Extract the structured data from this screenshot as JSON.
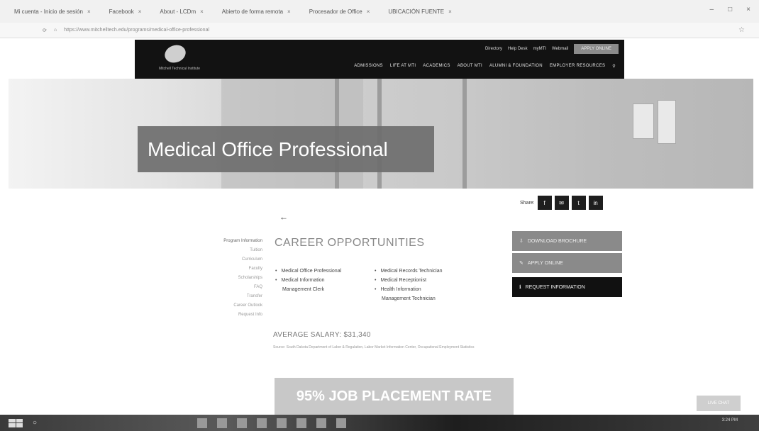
{
  "browser": {
    "tabs": [
      {
        "label": "Mi cuenta - Inicio de sesión"
      },
      {
        "label": "Facebook"
      },
      {
        "label": "About - LCDm"
      },
      {
        "label": "Abierto de forma remota"
      },
      {
        "label": "Procesador de Office"
      },
      {
        "label": "UBICACIÓN FUENTE"
      }
    ],
    "url": "https://www.mitchelltech.edu/programs/medical-office-professional",
    "window_controls": [
      "minimize",
      "maximize",
      "close"
    ]
  },
  "site": {
    "logo_text": "Mitchell Technical Institute",
    "top_links": [
      "Directory",
      "Help Desk",
      "myMTI",
      "Webmail"
    ],
    "apply_label": "APPLY ONLINE",
    "nav": [
      "ADMISSIONS",
      "LIFE AT MTI",
      "ACADEMICS",
      "ABOUT MTI",
      "ALUMNI & FOUNDATION",
      "EMPLOYER RESOURCES"
    ]
  },
  "hero": {
    "title": "Medical Office Professional"
  },
  "share": {
    "label": "Share:",
    "buttons": [
      "f",
      "✉",
      "t",
      "in"
    ]
  },
  "sidenav": {
    "items": [
      "Program Information",
      "Tuition",
      "Curriculum",
      "Faculty",
      "Scholarships",
      "FAQ",
      "Transfer",
      "Career Outlook",
      "Request Info"
    ]
  },
  "career": {
    "title": "CAREER OPPORTUNITIES",
    "left_col": [
      "Medical Office Professional",
      "Medical Information",
      "Management Clerk"
    ],
    "right_col": [
      "Medical Records Technician",
      "Medical Receptionist",
      "Health Information",
      "Management Technician"
    ]
  },
  "salary": {
    "title": "AVERAGE SALARY: $31,340",
    "text": "Source: South Dakota Department of Labor & Regulation, Labor Market Information Center, Occupational Employment Statistics"
  },
  "placement": {
    "text": "95% JOB PLACEMENT RATE"
  },
  "actions": {
    "download": "DOWNLOAD BROCHURE",
    "apply": "APPLY ONLINE",
    "request": "REQUEST INFORMATION"
  },
  "chat": {
    "label": "LIVE CHAT"
  },
  "taskbar": {
    "clock": "3:24 PM"
  }
}
